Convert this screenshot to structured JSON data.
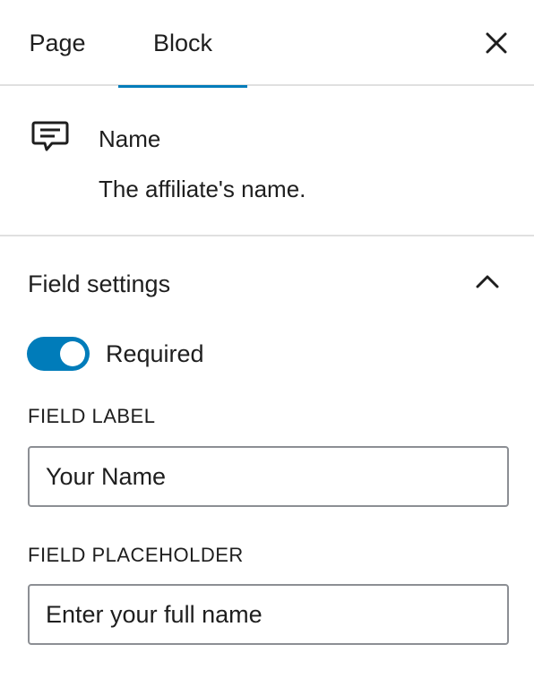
{
  "tabs": [
    {
      "label": "Page",
      "active": false
    },
    {
      "label": "Block",
      "active": true
    }
  ],
  "header": {
    "close_icon": "close-icon"
  },
  "block": {
    "icon": "comment-form-icon",
    "title": "Name",
    "description": "The affiliate's name."
  },
  "field_settings": {
    "title": "Field settings",
    "expanded": true,
    "required": {
      "label": "Required",
      "checked": true
    },
    "field_label": {
      "label": "FIELD LABEL",
      "value": "Your Name"
    },
    "field_placeholder": {
      "label": "FIELD PLACEHOLDER",
      "value": "Enter your full name"
    }
  },
  "colors": {
    "accent": "#007cba",
    "border": "#8c8f94",
    "divider": "#e0e0e0",
    "text": "#1e1e1e"
  }
}
